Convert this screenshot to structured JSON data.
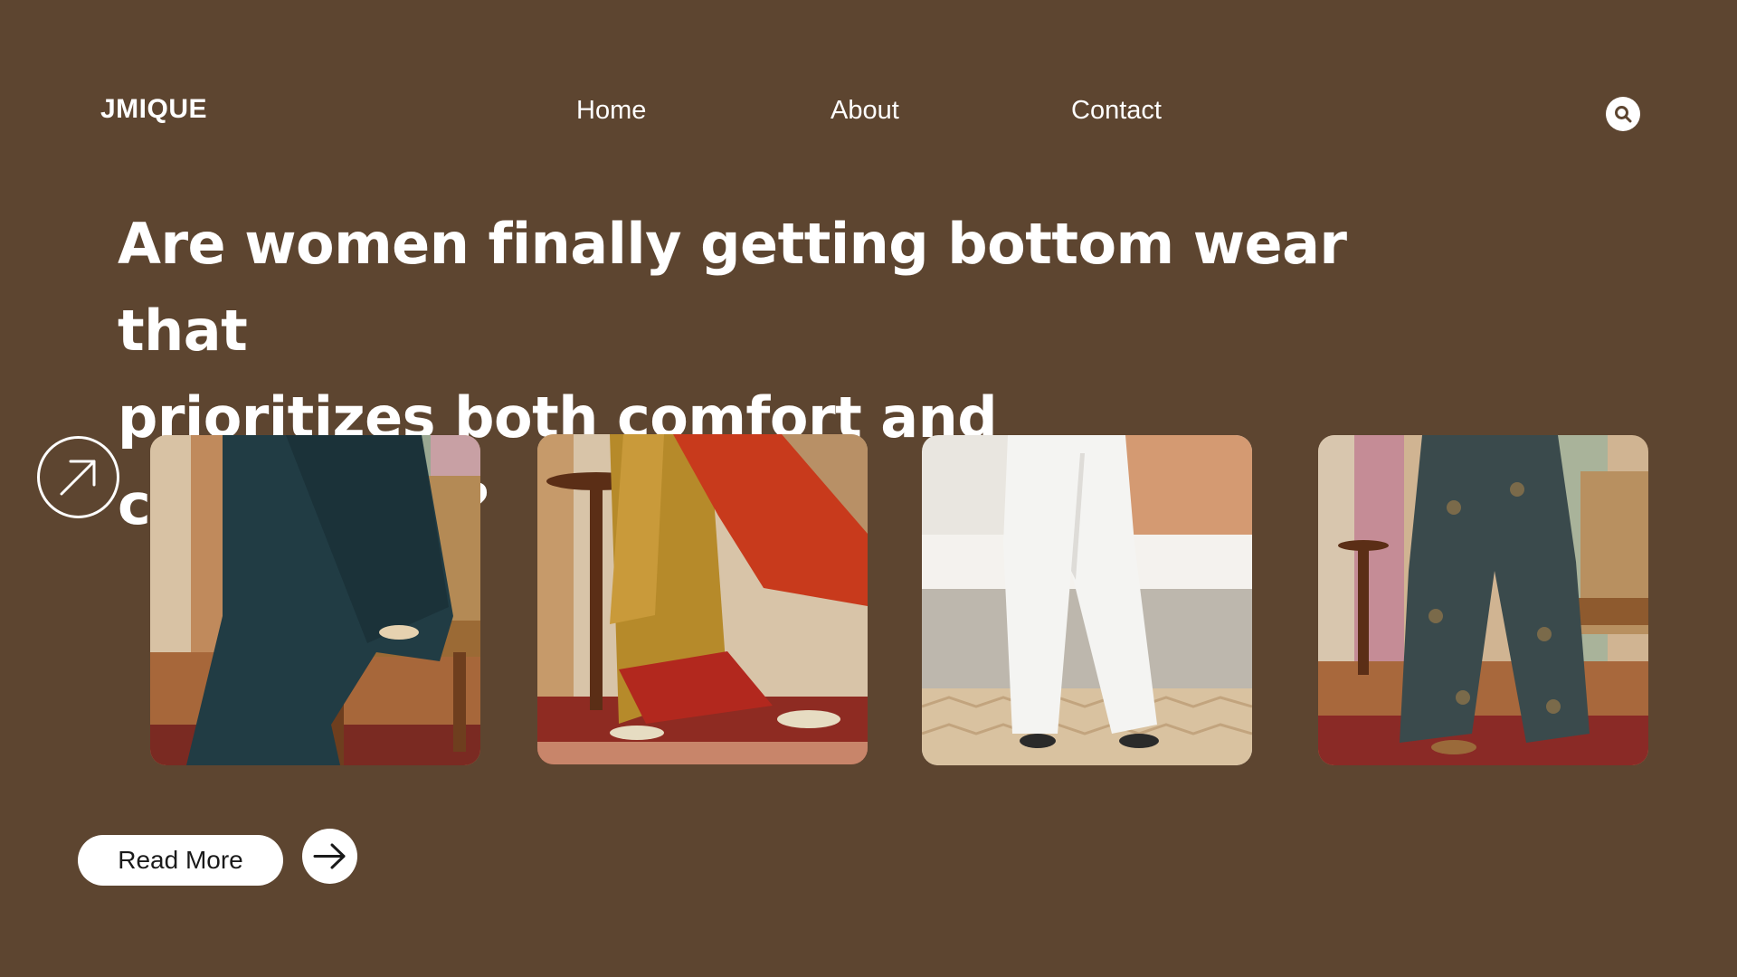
{
  "header": {
    "logo": "JMIQUE",
    "nav": [
      {
        "label": "Home"
      },
      {
        "label": "About"
      },
      {
        "label": "Contact"
      }
    ],
    "search_icon": "search-icon"
  },
  "hero": {
    "headline_line1": "Are women finally getting bottom wear that",
    "headline_line2": "prioritizes both comfort and confidence?"
  },
  "gallery": {
    "expand_icon": "arrow-up-right-icon",
    "items": [
      {
        "name": "dark-teal-wide-leg-pants",
        "color": "#213c44"
      },
      {
        "name": "red-printed-pants-with-dupatta",
        "color": "#b83a1e"
      },
      {
        "name": "white-straight-pants",
        "color": "#eeeeec"
      },
      {
        "name": "printed-palazzo-pants",
        "color": "#3a4a4c"
      }
    ]
  },
  "actions": {
    "read_more_label": "Read More",
    "next_icon": "arrow-right-icon"
  },
  "colors": {
    "background": "#5d4530",
    "text": "#ffffff",
    "button_bg": "#ffffff",
    "button_text": "#1a1a1a"
  }
}
